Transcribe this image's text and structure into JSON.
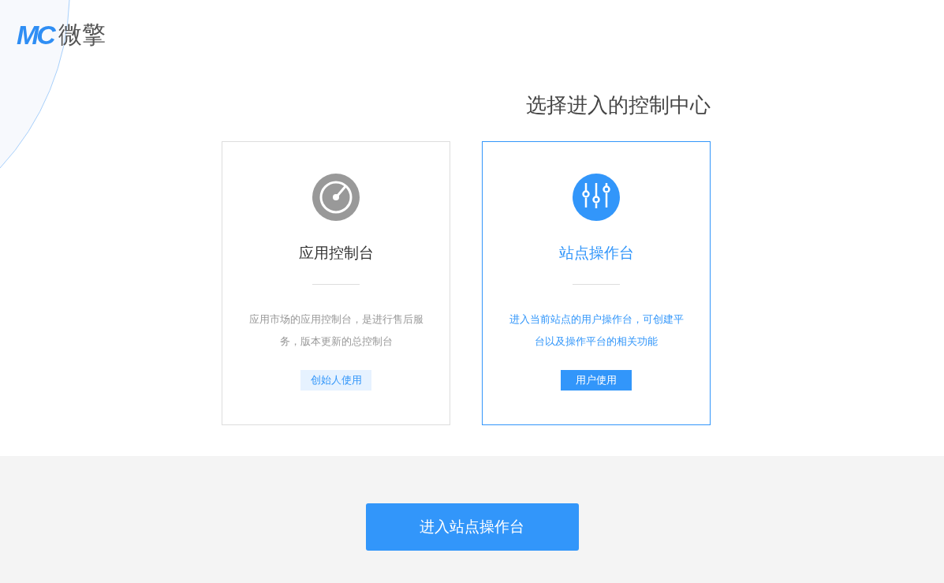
{
  "logo": {
    "mark": "MC",
    "name": "微擎"
  },
  "heading": "选择进入的控制中心",
  "cards": [
    {
      "kind": "gauge",
      "title": "应用控制台",
      "description": "应用市场的应用控制台，是进行售后服务，版本更新的总控制台",
      "tag": "创始人使用",
      "selected": false
    },
    {
      "kind": "sliders",
      "title": "站点操作台",
      "description": "进入当前站点的用户操作台，可创建平台以及操作平台的相关功能",
      "tag": "用户使用",
      "selected": true
    }
  ],
  "enter_button": "进入站点操作台"
}
